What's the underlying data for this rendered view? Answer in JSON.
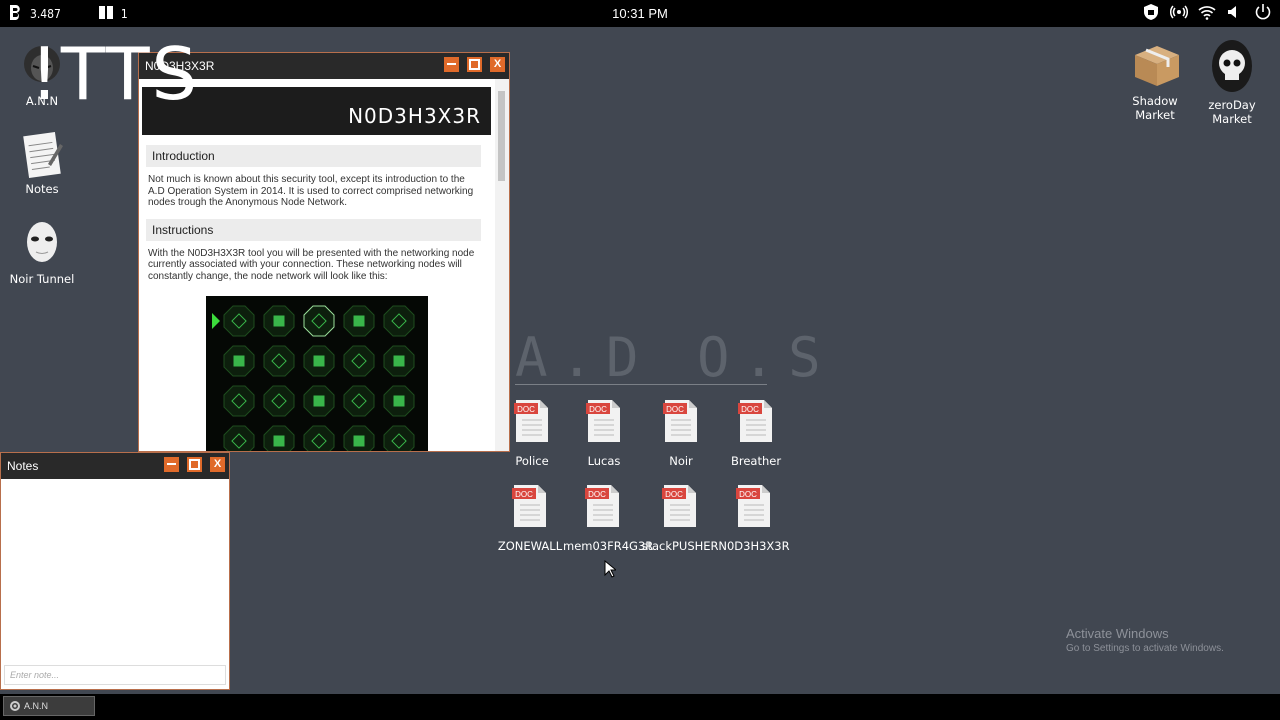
{
  "topbar": {
    "credits": "3.487",
    "notes_count": "1",
    "clock": "10:31 PM"
  },
  "overlay_text": "!TTS",
  "desktop_left": [
    {
      "label": "A.N.N",
      "icon": "hacker-mask-icon"
    },
    {
      "label": "Notes",
      "icon": "notepad-icon"
    },
    {
      "label": "Noir Tunnel",
      "icon": "white-mask-icon"
    }
  ],
  "desktop_right": [
    {
      "label": "Shadow Market",
      "icon": "package-box-icon"
    },
    {
      "label": "zeroDay Market",
      "icon": "skull-icon"
    }
  ],
  "nodehexer_window": {
    "title": "N0D3H3X3R",
    "banner": "N0D3H3X3R",
    "sections": [
      {
        "heading": "Introduction",
        "body": "Not much is known about this security tool, except its introduction to the A.D Operation System in 2014. It is used to correct comprised networking nodes trough the Anonymous Node Network."
      },
      {
        "heading": "Instructions",
        "body": "With the N0D3H3X3R tool you will be presented with the networking node currently associated with your connection. These networking nodes will constantly change, the node network will look like this:"
      }
    ]
  },
  "notes_window": {
    "title": "Notes",
    "placeholder": "Enter note..."
  },
  "ados_logo": "A.D O.S",
  "doc_badge": "DOC",
  "documents": [
    {
      "label": "Police"
    },
    {
      "label": "Lucas"
    },
    {
      "label": "Noir"
    },
    {
      "label": "Breather"
    },
    {
      "label": "ZONEWALL"
    },
    {
      "label": "mem03FR4G3R"
    },
    {
      "label": "stackPUSHER"
    },
    {
      "label": "N0D3H3X3R"
    }
  ],
  "watermark": {
    "line1": "Activate Windows",
    "line2": "Go to Settings to activate Windows."
  },
  "taskbar": {
    "item": "A.N.N"
  },
  "colors": {
    "desktop": "#414751",
    "window_accent": "#e06a2a",
    "doc_badge": "#d9463e",
    "node_green": "#39b54a"
  }
}
